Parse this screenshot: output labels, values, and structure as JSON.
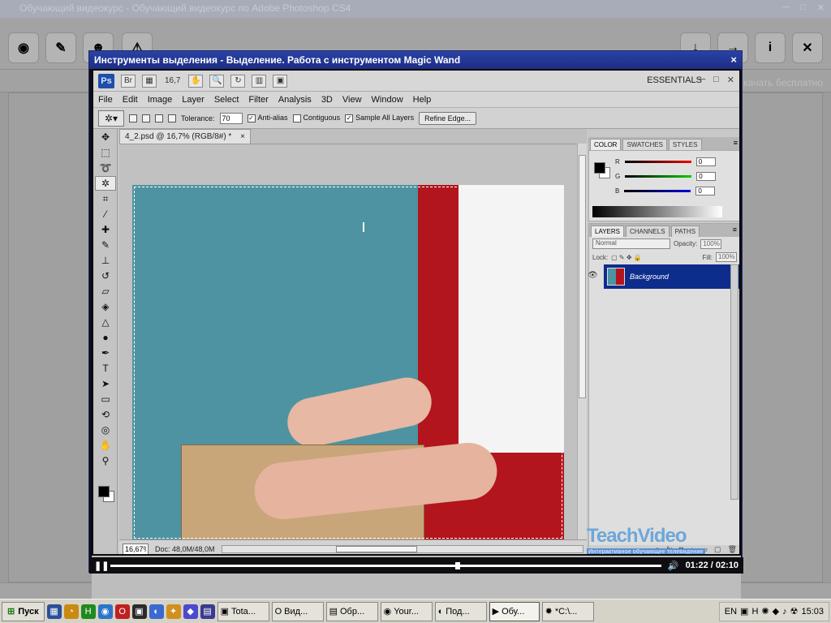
{
  "background_app": {
    "title": "Обучающий видеокурс - Обучающий видеокурс по Adobe Photoshop CS4",
    "download_text": "Скачать бесплатно"
  },
  "player": {
    "title": "Инструменты выделения - Выделение. Работа с инструментом Magic Wand",
    "close": "×",
    "time": "01:22 / 02:10",
    "progress_fraction": 0.63
  },
  "photoshop": {
    "logo": "Ps",
    "bridge_label": "Br",
    "zoom_level": "16,7",
    "workspace": "ESSENTIALS",
    "menu": [
      "File",
      "Edit",
      "Image",
      "Layer",
      "Select",
      "Filter",
      "Analysis",
      "3D",
      "View",
      "Window",
      "Help"
    ],
    "options": {
      "tolerance_label": "Tolerance:",
      "tolerance_value": "70",
      "antialias": "Anti-alias",
      "contiguous": "Contiguous",
      "sample_all": "Sample All Layers",
      "refine": "Refine Edge..."
    },
    "document": {
      "tab": "4_2.psd @ 16,7% (RGB/8#) *",
      "zoom": "16,67%",
      "doc_size": "Doc: 48,0M/48,0M"
    },
    "color_panel": {
      "tabs": [
        "COLOR",
        "SWATCHES",
        "STYLES"
      ],
      "r_label": "R",
      "g_label": "G",
      "b_label": "B",
      "r": "0",
      "g": "0",
      "b": "0"
    },
    "layers_panel": {
      "tabs": [
        "LAYERS",
        "CHANNELS",
        "PATHS"
      ],
      "blend_mode": "Normal",
      "opacity_label": "Opacity:",
      "opacity": "100%",
      "lock_label": "Lock:",
      "fill_label": "Fill:",
      "fill": "100%",
      "layer_name": "Background"
    },
    "watermark": {
      "title": "TeachVideo",
      "subtitle": "Интерактивное обучающее телевидение"
    }
  },
  "taskbar": {
    "start": "Пуск",
    "tasks": [
      "Tota...",
      "Вид...",
      "Обр...",
      "Your...",
      "Под...",
      "Обу...",
      "*C:\\..."
    ],
    "lang": "EN",
    "clock": "15:03"
  }
}
